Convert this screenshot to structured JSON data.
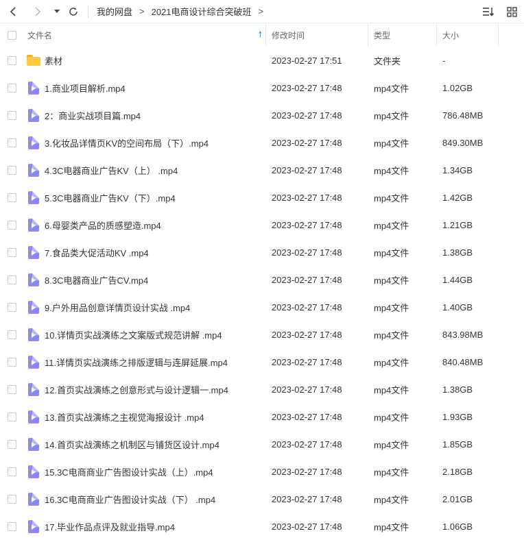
{
  "toolbar": {
    "breadcrumbs": [
      "我的网盘",
      "2021电商设计综合突破班"
    ],
    "separator": ">"
  },
  "columns": {
    "name": "文件名",
    "modified": "修改时间",
    "type": "类型",
    "size": "大小"
  },
  "files": [
    {
      "kind": "folder",
      "name": "素材",
      "modified": "2023-02-27 17:51",
      "type": "文件夹",
      "size": "-"
    },
    {
      "kind": "video",
      "name": "1.商业项目解析.mp4",
      "modified": "2023-02-27 17:48",
      "type": "mp4文件",
      "size": "1.02GB"
    },
    {
      "kind": "video",
      "name": "2：商业实战项目篇.mp4",
      "modified": "2023-02-27 17:48",
      "type": "mp4文件",
      "size": "786.48MB"
    },
    {
      "kind": "video",
      "name": "3.化妆品详情页KV的空间布局（下）.mp4",
      "modified": "2023-02-27 17:48",
      "type": "mp4文件",
      "size": "849.30MB"
    },
    {
      "kind": "video",
      "name": "4.3C电器商业广告KV（上） .mp4",
      "modified": "2023-02-27 17:48",
      "type": "mp4文件",
      "size": "1.34GB"
    },
    {
      "kind": "video",
      "name": "5.3C电器商业广告KV（下）.mp4",
      "modified": "2023-02-27 17:48",
      "type": "mp4文件",
      "size": "1.42GB"
    },
    {
      "kind": "video",
      "name": "6.母婴类产品的质感塑造.mp4",
      "modified": "2023-02-27 17:48",
      "type": "mp4文件",
      "size": "1.21GB"
    },
    {
      "kind": "video",
      "name": "7.食品类大促活动KV .mp4",
      "modified": "2023-02-27 17:48",
      "type": "mp4文件",
      "size": "1.38GB"
    },
    {
      "kind": "video",
      "name": "8.3C电器商业广告CV.mp4",
      "modified": "2023-02-27 17:48",
      "type": "mp4文件",
      "size": "1.44GB"
    },
    {
      "kind": "video",
      "name": "9.户外用品创意详情页设计实战 .mp4",
      "modified": "2023-02-27 17:48",
      "type": "mp4文件",
      "size": "1.40GB"
    },
    {
      "kind": "video",
      "name": "10.详情页实战演练之文案版式规范讲解 .mp4",
      "modified": "2023-02-27 17:48",
      "type": "mp4文件",
      "size": "843.98MB"
    },
    {
      "kind": "video",
      "name": "11.详情页实战演练之排版逻辑与连屏延展.mp4",
      "modified": "2023-02-27 17:48",
      "type": "mp4文件",
      "size": "840.48MB"
    },
    {
      "kind": "video",
      "name": "12.首页实战演练之创意形式与设计逻辑一.mp4",
      "modified": "2023-02-27 17:48",
      "type": "mp4文件",
      "size": "1.38GB"
    },
    {
      "kind": "video",
      "name": "13.首页实战演练之主视觉海报设计  .mp4",
      "modified": "2023-02-27 17:48",
      "type": "mp4文件",
      "size": "1.93GB"
    },
    {
      "kind": "video",
      "name": "14.首页实战演练之机制区与铺货区设计.mp4",
      "modified": "2023-02-27 17:48",
      "type": "mp4文件",
      "size": "1.85GB"
    },
    {
      "kind": "video",
      "name": "15.3C电商商业广告图设计实战（上）.mp4",
      "modified": "2023-02-27 17:48",
      "type": "mp4文件",
      "size": "2.18GB"
    },
    {
      "kind": "video",
      "name": "16.3C电商商业广告图设计实战（下） .mp4",
      "modified": "2023-02-27 17:48",
      "type": "mp4文件",
      "size": "2.01GB"
    },
    {
      "kind": "video",
      "name": "17.毕业作品点评及就业指导.mp4",
      "modified": "2023-02-27 17:48",
      "type": "mp4文件",
      "size": "1.06GB"
    }
  ],
  "colors": {
    "accent": "#1e90ff",
    "folder": "#ffc83d",
    "video": "#8f86f0"
  }
}
